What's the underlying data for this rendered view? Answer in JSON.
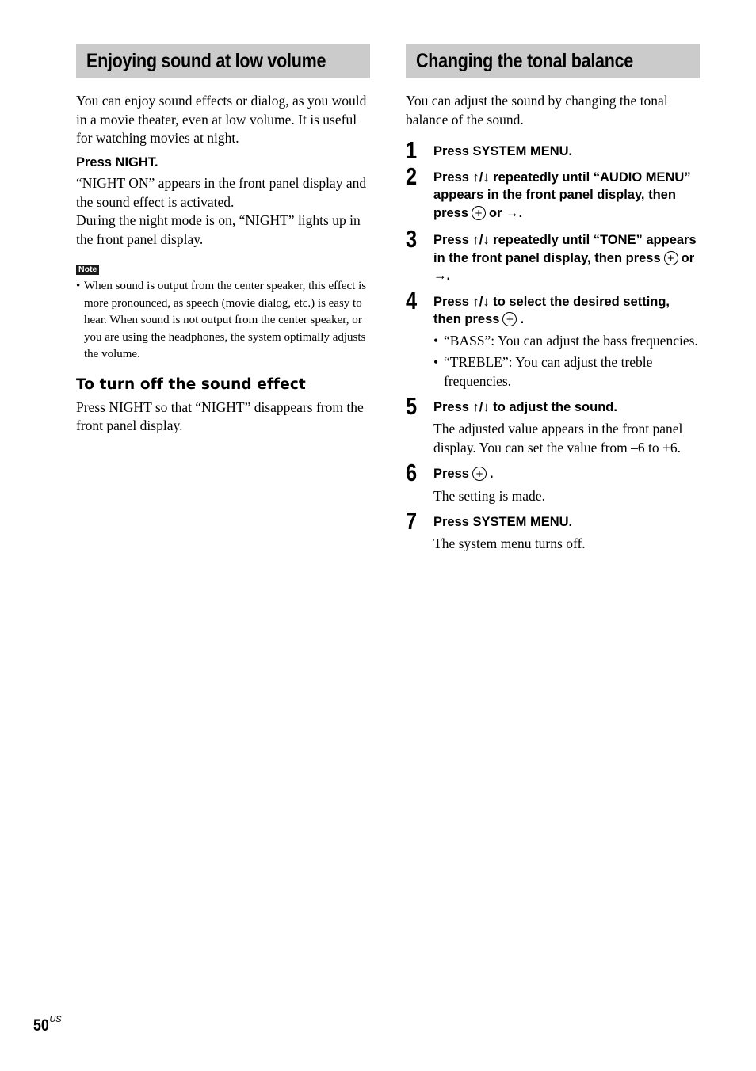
{
  "left": {
    "title": "Enjoying sound at low volume",
    "intro": "You can enjoy sound effects or dialog, as you would in a movie theater, even at low volume. It is useful for watching movies at night.",
    "instruction": "Press NIGHT.",
    "result_1": "“NIGHT ON” appears in the front panel display and the sound effect is activated.",
    "result_2": "During the night mode is on, “NIGHT” lights up in the front panel display.",
    "note_label": "Note",
    "note_bullet": "•",
    "note_text": "When sound is output from the center speaker, this effect is more pronounced, as speech (movie dialog, etc.) is easy to hear. When sound is not output from the center speaker, or you are using the headphones, the system optimally adjusts the volume.",
    "subheading": "To turn off the sound effect",
    "turn_off_text": "Press NIGHT so that “NIGHT” disappears from the front panel display."
  },
  "right": {
    "title": "Changing the tonal balance",
    "intro": "You can adjust the sound by changing the tonal balance of the sound.",
    "steps": [
      {
        "num": "1",
        "a": "Press SYSTEM MENU."
      },
      {
        "num": "2",
        "a": "Press ↑/↓ repeatedly until “AUDIO MENU” appears in the front panel display, then press",
        "b": "or →."
      },
      {
        "num": "3",
        "a": "Press ↑/↓ repeatedly until “TONE” appears in the front panel display, then press",
        "b": "or →."
      },
      {
        "num": "4",
        "a": "Press ↑/↓ to select the desired setting, then press",
        "b": ".",
        "bullets": [
          "“BASS”: You can adjust the bass frequencies.",
          "“TREBLE”: You can adjust the treble frequencies."
        ]
      },
      {
        "num": "5",
        "a": "Press ↑/↓ to adjust the sound.",
        "detail": "The adjusted value appears in the front panel display. You can set the value from –6 to +6."
      },
      {
        "num": "6",
        "a": "Press",
        "b": ".",
        "detail": "The setting is made."
      },
      {
        "num": "7",
        "a": "Press SYSTEM MENU.",
        "detail": "The system menu turns off."
      }
    ],
    "bullet": "•"
  },
  "footer": {
    "page_number": "50",
    "region": "US"
  },
  "icons": {
    "enter_button": "circle-plus-enter-icon"
  }
}
